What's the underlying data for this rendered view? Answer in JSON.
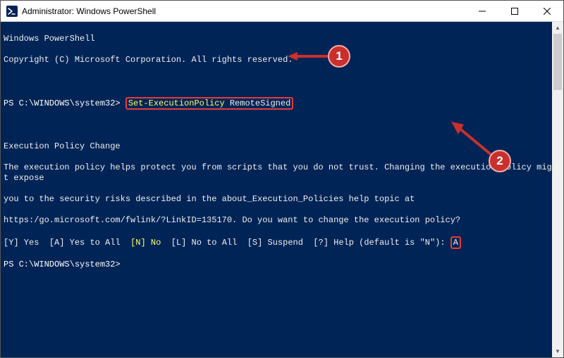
{
  "window": {
    "title": "Administrator: Windows PowerShell"
  },
  "terminal": {
    "banner1": "Windows PowerShell",
    "banner2": "Copyright (C) Microsoft Corporation. All rights reserved.",
    "prompt1_prefix": "PS C:\\WINDOWS\\system32> ",
    "cmd_part1": "Set-ExecutionPolicy",
    "cmd_part2": " RemoteSigned",
    "policy_head": "Execution Policy Change",
    "policy_body1": "The execution policy helps protect you from scripts that you do not trust. Changing the execution policy might expose",
    "policy_body2": "you to the security risks described in the about_Execution_Policies help topic at",
    "policy_body3": "https:/go.microsoft.com/fwlink/?LinkID=135170. Do you want to change the execution policy?",
    "opt_y": "[Y] Yes",
    "opt_a": "[A] Yes to All",
    "opt_n": "[N] No",
    "opt_l": "[L] No to All",
    "opt_s": "[S] Suspend",
    "opt_h": "[?] Help (default is \"N\"): ",
    "answer": "A",
    "prompt2": "PS C:\\WINDOWS\\system32>"
  },
  "annotations": {
    "bubble1": "1",
    "bubble2": "2"
  }
}
